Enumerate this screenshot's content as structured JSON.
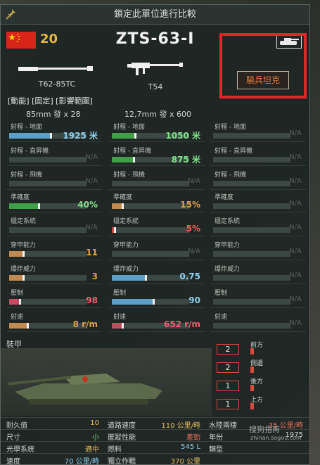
{
  "title_bar": {
    "text": "鎖定此單位進行比較"
  },
  "header": {
    "tier": "20",
    "tank_name": "ZTS-63-I",
    "class_tag": "驍兵坦克"
  },
  "weapons": [
    {
      "label": "T62-85TC"
    },
    {
      "label": "T54"
    }
  ],
  "weapon_tags": "[動能] [固定] [影響範圍]",
  "ammo": [
    {
      "caliber": "85mm",
      "rounds": "x 28"
    },
    {
      "caliber": "12,7mm",
      "rounds": "x 600"
    }
  ],
  "stats": [
    [
      {
        "label": "射程 - 地面",
        "value": "1925 米",
        "fill": 0.55,
        "color": "#5aa0c8",
        "value_color": "#8fd0f0"
      },
      {
        "label": "射程 - 地面",
        "value": "1050 米",
        "fill": 0.32,
        "color": "#3fa048",
        "value_color": "#7fe08a"
      },
      {
        "label": "射程 - 地面",
        "value": "N/A",
        "fill": 0,
        "color": "",
        "value_color": ""
      }
    ],
    [
      {
        "label": "射程 - 直昇機",
        "value": "N/A",
        "fill": 0,
        "color": "",
        "value_color": ""
      },
      {
        "label": "射程 - 直昇機",
        "value": "875 米",
        "fill": 0.3,
        "color": "#3fa048",
        "value_color": "#7fe08a"
      },
      {
        "label": "射程 - 直昇機",
        "value": "N/A",
        "fill": 0,
        "color": "",
        "value_color": ""
      }
    ],
    [
      {
        "label": "射程 - 飛機",
        "value": "N/A",
        "fill": 0,
        "color": "",
        "value_color": ""
      },
      {
        "label": "射程 - 飛機",
        "value": "N/A",
        "fill": 0,
        "color": "",
        "value_color": ""
      },
      {
        "label": "射程 - 飛機",
        "value": "N/A",
        "fill": 0,
        "color": "",
        "value_color": ""
      }
    ],
    [
      {
        "label": "準確度",
        "value": "40%",
        "fill": 0.4,
        "color": "#3fa048",
        "value_color": "#7fe08a"
      },
      {
        "label": "準確度",
        "value": "15%",
        "fill": 0.15,
        "color": "#c08a50",
        "value_color": "#e0a050"
      },
      {
        "label": "準確度",
        "value": "N/A",
        "fill": 0,
        "color": "",
        "value_color": ""
      }
    ],
    [
      {
        "label": "穩定系統",
        "value": "N/A",
        "fill": 0,
        "color": "",
        "value_color": ""
      },
      {
        "label": "穩定系統",
        "value": "5%",
        "fill": 0.05,
        "color": "#c84a40",
        "value_color": "#f06058"
      },
      {
        "label": "穩定系統",
        "value": "N/A",
        "fill": 0,
        "color": "",
        "value_color": ""
      }
    ],
    [
      {
        "label": "穿甲能力",
        "value": "11",
        "fill": 0.2,
        "color": "#c08a50",
        "value_color": "#e0a050"
      },
      {
        "label": "穿甲能力",
        "value": "N/A",
        "fill": 0,
        "color": "",
        "value_color": ""
      },
      {
        "label": "穿甲能力",
        "value": "N/A",
        "fill": 0,
        "color": "",
        "value_color": ""
      }
    ],
    [
      {
        "label": "爆炸威力",
        "value": "3",
        "fill": 0.2,
        "color": "#c08a50",
        "value_color": "#e0a050"
      },
      {
        "label": "爆炸威力",
        "value": "0.75",
        "fill": 0.45,
        "color": "#5aa0c8",
        "value_color": "#8fd0f0"
      },
      {
        "label": "爆炸威力",
        "value": "N/A",
        "fill": 0,
        "color": "",
        "value_color": ""
      }
    ],
    [
      {
        "label": "壓制",
        "value": "98",
        "fill": 0.15,
        "color": "#c84a60",
        "value_color": "#f06070"
      },
      {
        "label": "壓制",
        "value": "90",
        "fill": 0.55,
        "color": "#5aa0c8",
        "value_color": "#8fd0f0"
      },
      {
        "label": "壓制",
        "value": "N/A",
        "fill": 0,
        "color": "",
        "value_color": ""
      }
    ],
    [
      {
        "label": "射速",
        "value": "8 r/m",
        "fill": 0.25,
        "color": "#c08a50",
        "value_color": "#e0a050"
      },
      {
        "label": "射速",
        "value": "652 r/m",
        "fill": 0.15,
        "color": "#c84a60",
        "value_color": "#f06070"
      },
      {
        "label": "射速",
        "value": "N/A",
        "fill": 0,
        "color": "",
        "value_color": ""
      }
    ]
  ],
  "armor": {
    "title": "裝甲",
    "front": {
      "label": "前方",
      "value": "2"
    },
    "side": {
      "label": "側邊",
      "value": "2"
    },
    "rear": {
      "label": "後方",
      "value": "1"
    },
    "top": {
      "label": "上方",
      "value": "1"
    }
  },
  "bottom": [
    [
      {
        "label": "耐久值",
        "value": "10",
        "color": "#e8c060"
      },
      {
        "label": "道路速度",
        "value": "110 公里/時",
        "color": "#e8c060"
      },
      {
        "label": "水陸兩棲",
        "value": "35 公里/時",
        "color": "#f07060"
      }
    ],
    [
      {
        "label": "尺寸",
        "value": "小",
        "color": "#7fe08a"
      },
      {
        "label": "匿蹤性能",
        "value": "差勁",
        "color": "#f07060"
      },
      {
        "label": "年份",
        "value": "1975",
        "color": "#cfd6cf"
      }
    ],
    [
      {
        "label": "光學系統",
        "value": "適中",
        "color": "#e8c060"
      },
      {
        "label": "燃料",
        "value": "545 L",
        "color": "#8fd0f0"
      },
      {
        "label": "類型",
        "value": "",
        "color": "#cfd6cf"
      }
    ],
    [
      {
        "label": "速度",
        "value": "70 公里/時",
        "color": "#8fd0f0"
      },
      {
        "label": "獨立作戰",
        "value": "370 公里",
        "color": "#e8c060"
      },
      {
        "label": "",
        "value": "",
        "color": "#cfd6cf"
      }
    ]
  ],
  "watermark": {
    "main": "搜狗指南",
    "sub": "zhinan.sogou.com"
  }
}
